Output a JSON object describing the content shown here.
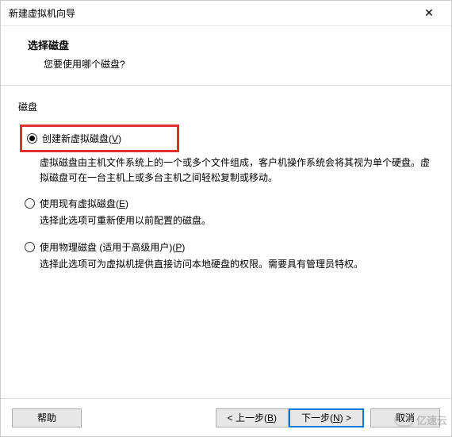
{
  "titlebar": {
    "title": "新建虚拟机向导",
    "close": "✕"
  },
  "header": {
    "title": "选择磁盘",
    "subtitle": "您要使用哪个磁盘?"
  },
  "group_label": "磁盘",
  "options": [
    {
      "label_prefix": "创建新虚拟磁盘(",
      "label_key": "V",
      "label_suffix": ")",
      "desc": "虚拟磁盘由主机文件系统上的一个或多个文件组成，客户机操作系统会将其视为单个硬盘。虚拟磁盘可在一台主机上或多台主机之间轻松复制或移动。",
      "checked": true,
      "highlighted": true
    },
    {
      "label_prefix": "使用现有虚拟磁盘(",
      "label_key": "E",
      "label_suffix": ")",
      "desc": "选择此选项可重新使用以前配置的磁盘。",
      "checked": false,
      "highlighted": false
    },
    {
      "label_prefix": "使用物理磁盘 (适用于高级用户)(",
      "label_key": "P",
      "label_suffix": ")",
      "desc": "选择此选项可为虚拟机提供直接访问本地硬盘的权限。需要具有管理员特权。",
      "checked": false,
      "highlighted": false
    }
  ],
  "footer": {
    "help": "帮助",
    "back_prefix": "< 上一步(",
    "back_key": "B",
    "back_suffix": ")",
    "next_prefix": "下一步(",
    "next_key": "N",
    "next_suffix": ") >",
    "cancel": "取消"
  },
  "watermark": "亿速云"
}
